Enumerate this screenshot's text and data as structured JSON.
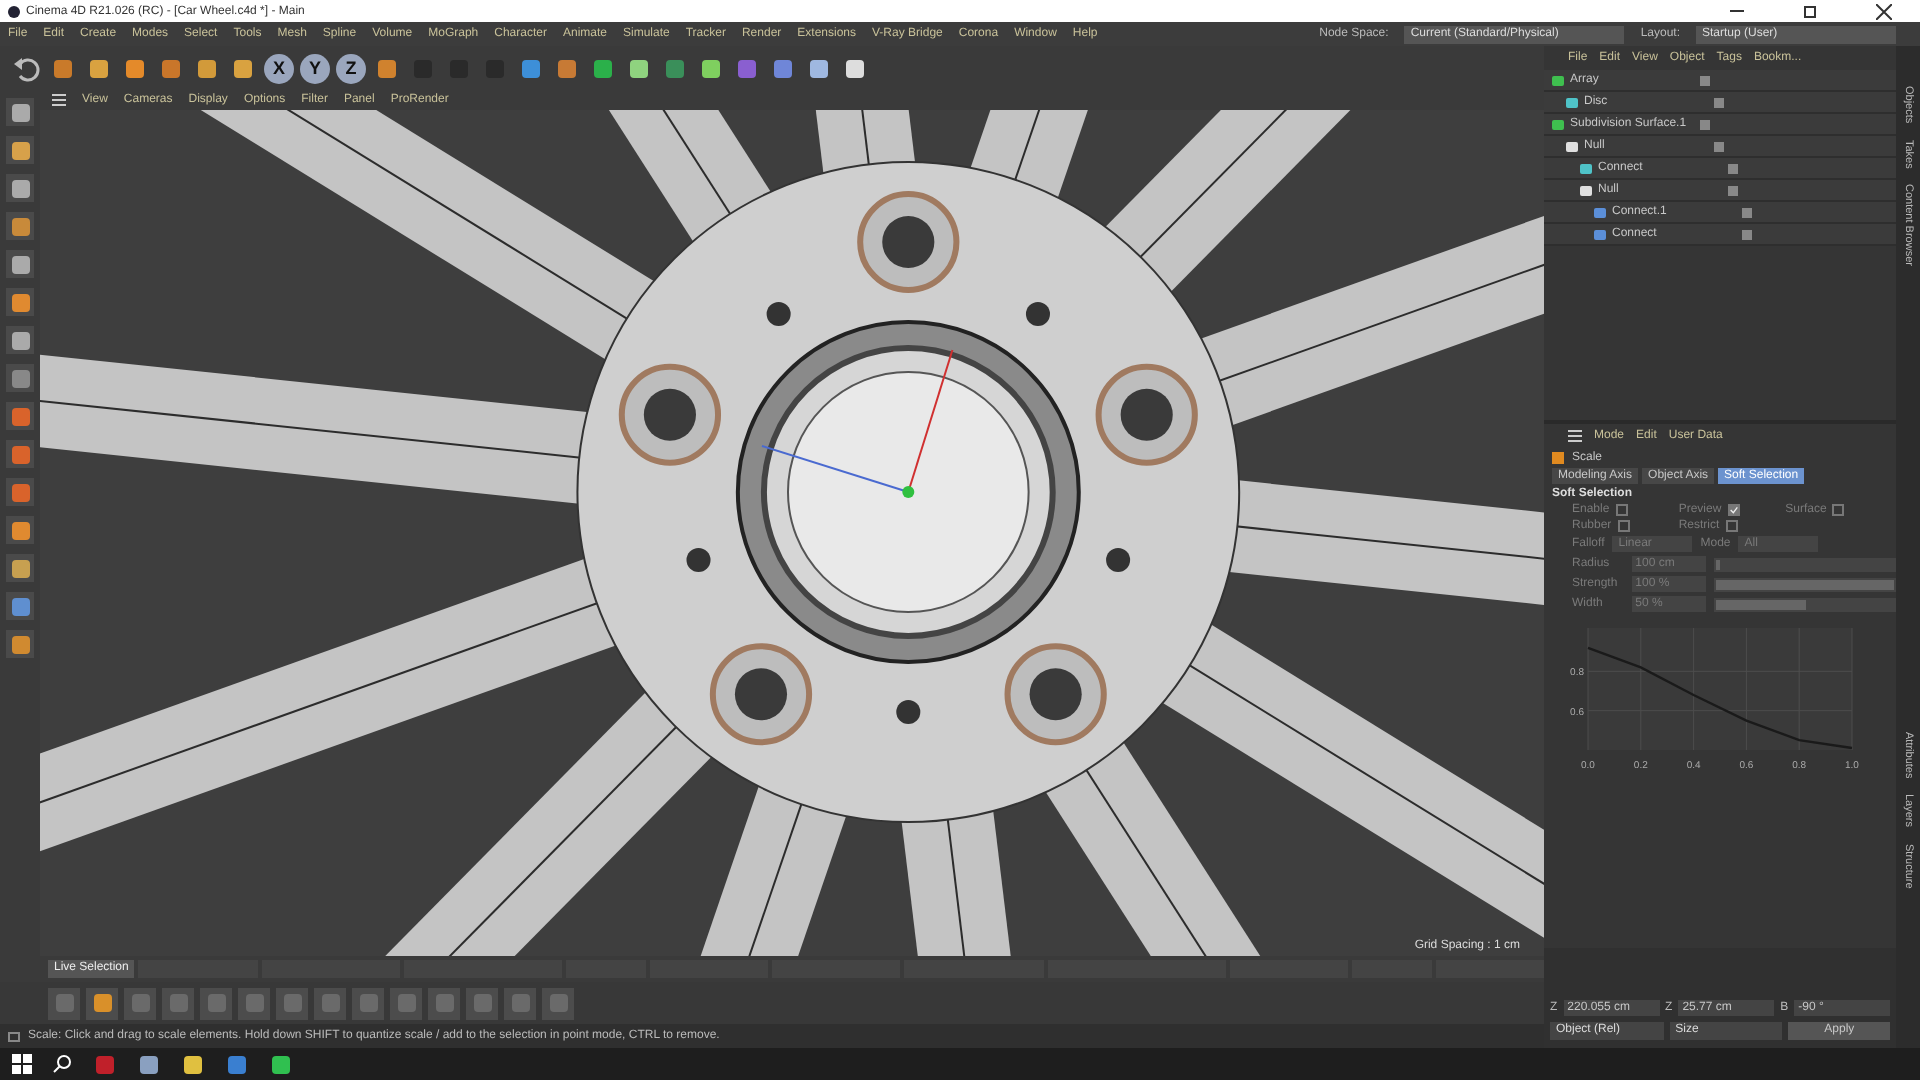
{
  "window": {
    "title": "Cinema 4D R21.026 (RC) - [Car Wheel.c4d *] - Main"
  },
  "menu": [
    "File",
    "Edit",
    "Create",
    "Modes",
    "Select",
    "Tools",
    "Mesh",
    "Spline",
    "Volume",
    "MoGraph",
    "Character",
    "Animate",
    "Simulate",
    "Tracker",
    "Render",
    "Extensions",
    "V-Ray Bridge",
    "Corona",
    "Window",
    "Help"
  ],
  "node_space": {
    "label": "Node Space:",
    "value": "Current (Standard/Physical)"
  },
  "layout": {
    "label": "Layout:",
    "value": "Startup (User)"
  },
  "axis_buttons": [
    "X",
    "Y",
    "Z"
  ],
  "viewport": {
    "menu": [
      "View",
      "Cameras",
      "Display",
      "Options",
      "Filter",
      "Panel",
      "ProRender"
    ],
    "grid_spacing": "Grid Spacing : 1 cm"
  },
  "object_manager": {
    "menu": [
      "File",
      "Edit",
      "View",
      "Object",
      "Tags",
      "Bookm..."
    ],
    "tree": [
      {
        "name": "Array",
        "kind": "generator",
        "children": [
          {
            "name": "Disc",
            "kind": "primitive"
          }
        ]
      },
      {
        "name": "Subdivision Surface.1",
        "kind": "generator",
        "children": [
          {
            "name": "Null",
            "kind": "null",
            "children": [
              {
                "name": "Connect",
                "kind": "primitive"
              },
              {
                "name": "Null",
                "kind": "null",
                "children": [
                  {
                    "name": "Connect.1",
                    "kind": "mesh"
                  },
                  {
                    "name": "Connect",
                    "kind": "mesh"
                  }
                ]
              }
            ]
          }
        ]
      }
    ]
  },
  "side_tabs_top": [
    "Objects",
    "Takes",
    "Content Browser"
  ],
  "side_tabs_bottom": [
    "Attributes",
    "Layers",
    "Structure"
  ],
  "attribute_manager": {
    "menu": [
      "Mode",
      "Edit",
      "User Data"
    ],
    "tool": "Scale",
    "tabs": [
      {
        "label": "Modeling Axis",
        "selected": false
      },
      {
        "label": "Object Axis",
        "selected": false
      },
      {
        "label": "Soft Selection",
        "selected": true
      }
    ],
    "section": "Soft Selection",
    "disabled": true,
    "checks": [
      {
        "label": "Enable",
        "checked": false
      },
      {
        "label": "Preview",
        "checked": true
      },
      {
        "label": "Surface",
        "checked": false
      },
      {
        "label": "Rubber",
        "checked": false
      },
      {
        "label": "Restrict",
        "checked": false
      }
    ],
    "dropdowns": [
      {
        "label": "Falloff",
        "value": "Linear"
      },
      {
        "label": "Mode",
        "value": "All"
      }
    ],
    "sliders": [
      {
        "label": "Radius",
        "value": "100 cm",
        "level": 0.02
      },
      {
        "label": "Strength",
        "value": "100 %",
        "level": 1.0
      },
      {
        "label": "Width",
        "value": "50 %",
        "level": 0.5
      }
    ],
    "chart_data": {
      "type": "line",
      "x": [
        0.0,
        0.2,
        0.4,
        0.6,
        0.8,
        1.0
      ],
      "grid": true,
      "series": [
        {
          "color": "#1a1a1a",
          "values": [
            0.92,
            0.82,
            0.68,
            0.55,
            0.45,
            0.41
          ]
        }
      ],
      "xlim": [
        0,
        1
      ],
      "ylim": [
        0.4,
        1.0
      ],
      "xticks": [
        {
          "value": 0,
          "label": "0.0"
        },
        {
          "value": 0.2,
          "label": "0.2"
        },
        {
          "value": 0.4,
          "label": "0.4"
        },
        {
          "value": 0.6,
          "label": "0.6"
        },
        {
          "value": 0.8,
          "label": "0.8"
        },
        {
          "value": 1,
          "label": "1.0"
        }
      ],
      "yticks": [
        {
          "value": 0.8,
          "label": "0.8"
        },
        {
          "value": 0.6,
          "label": "0.6"
        }
      ]
    }
  },
  "tool_tabs": [
    {
      "label": "Live Selection",
      "selected": true
    }
  ],
  "status_bar": "Scale: Click and drag to scale elements. Hold down SHIFT to quantize scale / add to the selection in point mode, CTRL to remove.",
  "coordinates": {
    "row": [
      {
        "axis": "Z",
        "value": "220.055 cm"
      },
      {
        "axis": "Z",
        "value": "25.77 cm"
      },
      {
        "axis": "B",
        "value": "-90 °"
      }
    ],
    "dropdowns": [
      "Object (Rel)",
      "Size"
    ],
    "apply": "Apply"
  }
}
